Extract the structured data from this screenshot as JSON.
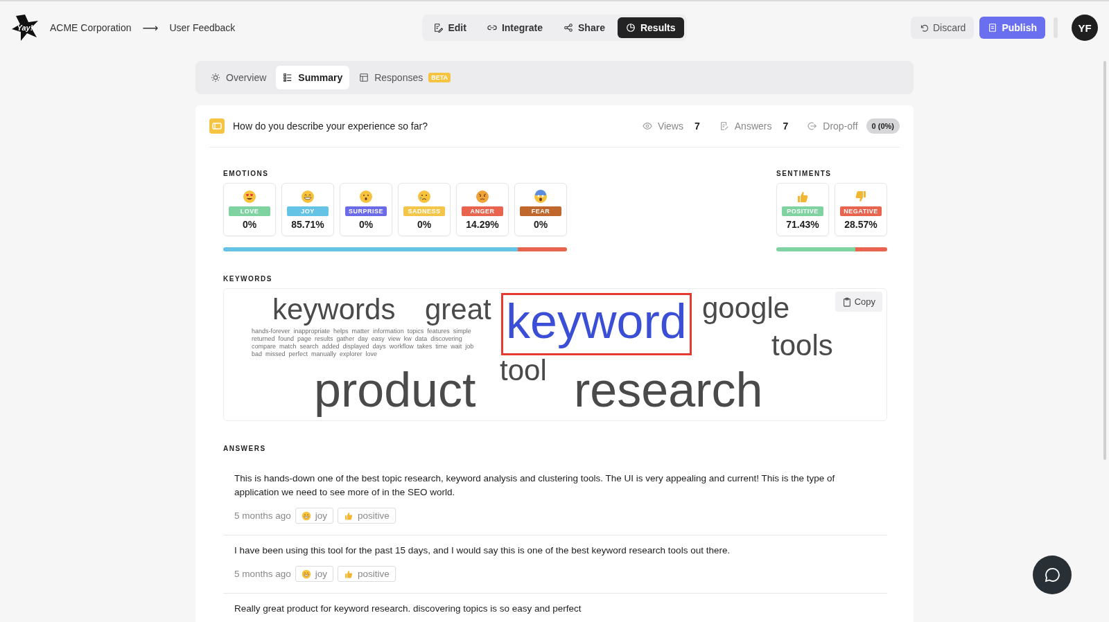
{
  "header": {
    "logo": "Yay!",
    "org": "ACME Corporation",
    "arrow": "⟶",
    "page": "User Feedback",
    "discard": "Discard",
    "publish": "Publish",
    "avatar": "YF"
  },
  "modes": [
    {
      "label": "Edit",
      "selected": false
    },
    {
      "label": "Integrate",
      "selected": false
    },
    {
      "label": "Share",
      "selected": false
    },
    {
      "label": "Results",
      "selected": true
    }
  ],
  "tabs": [
    {
      "label": "Overview",
      "selected": false
    },
    {
      "label": "Summary",
      "selected": true
    },
    {
      "label": "Responses",
      "badge": "BETA",
      "selected": false
    }
  ],
  "question": {
    "text": "How do you describe your experience so far?",
    "stats": [
      {
        "label": "Views",
        "value": "7"
      },
      {
        "label": "Answers",
        "value": "7"
      }
    ],
    "dropoff": {
      "label": "Drop-off",
      "value": "0 (0%)"
    }
  },
  "emotions": {
    "title": "EMOTIONS",
    "items": [
      {
        "kind": "love",
        "label": "LOVE",
        "value": "0%",
        "color": "#7fd3a0"
      },
      {
        "kind": "joy",
        "label": "JOY",
        "value": "85.71%",
        "color": "#65c3e6"
      },
      {
        "kind": "surprise",
        "label": "SURPRISE",
        "value": "0%",
        "color": "#6b6bea"
      },
      {
        "kind": "sadness",
        "label": "SADNESS",
        "value": "0%",
        "color": "#f3c64a"
      },
      {
        "kind": "anger",
        "label": "ANGER",
        "value": "14.29%",
        "color": "#e8644e"
      },
      {
        "kind": "fear",
        "label": "FEAR",
        "value": "0%",
        "color": "#c0672e"
      }
    ]
  },
  "sentiments": {
    "title": "SENTIMENTS",
    "items": [
      {
        "kind": "positive",
        "label": "POSITIVE",
        "value": "71.43%",
        "color": "#7fd3a0"
      },
      {
        "kind": "negative",
        "label": "NEGATIVE",
        "value": "28.57%",
        "color": "#e8644e"
      }
    ]
  },
  "keywords": {
    "title": "KEYWORDS",
    "copy": "Copy",
    "words": [
      {
        "text": "keywords",
        "kind": "large",
        "highlighted": false
      },
      {
        "text": "great",
        "kind": "large",
        "highlighted": false
      },
      {
        "text": "keyword",
        "kind": "huge",
        "highlighted": true
      },
      {
        "text": "google",
        "kind": "large",
        "highlighted": false
      },
      {
        "text": "tools",
        "kind": "large",
        "highlighted": false
      },
      {
        "text": "tool",
        "kind": "large",
        "highlighted": false
      },
      {
        "text": "product",
        "kind": "huge",
        "highlighted": false
      },
      {
        "text": "research",
        "kind": "huge",
        "highlighted": false
      }
    ],
    "minor_words": [
      "hands-forever",
      "inappropriate",
      "helps",
      "matter",
      "information",
      "topics",
      "features",
      "simple",
      "returned",
      "found",
      "page",
      "results",
      "gather",
      "day",
      "easy",
      "view",
      "kw",
      "data",
      "discovering",
      "compare",
      "match",
      "search",
      "added",
      "displayed",
      "days",
      "workflow",
      "takes",
      "time",
      "wait",
      "job",
      "bad",
      "missed",
      "perfect",
      "manually",
      "explorer",
      "love"
    ]
  },
  "answers": {
    "title": "ANSWERS",
    "items": [
      {
        "text": "This is hands-down one of the best topic research, keyword analysis and clustering tools. The UI is very appealing and current! This is the type of application we need to see more of in the SEO world.",
        "time": "5 months ago",
        "tags": [
          {
            "kind": "joy",
            "label": "joy"
          },
          {
            "kind": "positive",
            "label": "positive"
          }
        ]
      },
      {
        "text": "I have been using this tool for the past 15 days, and I would say this is one of the best keyword research tools out there.",
        "time": "5 months ago",
        "tags": [
          {
            "kind": "joy",
            "label": "joy"
          },
          {
            "kind": "positive",
            "label": "positive"
          }
        ]
      },
      {
        "text": "Really great product for keyword research. discovering topics is so easy and perfect"
      }
    ]
  }
}
